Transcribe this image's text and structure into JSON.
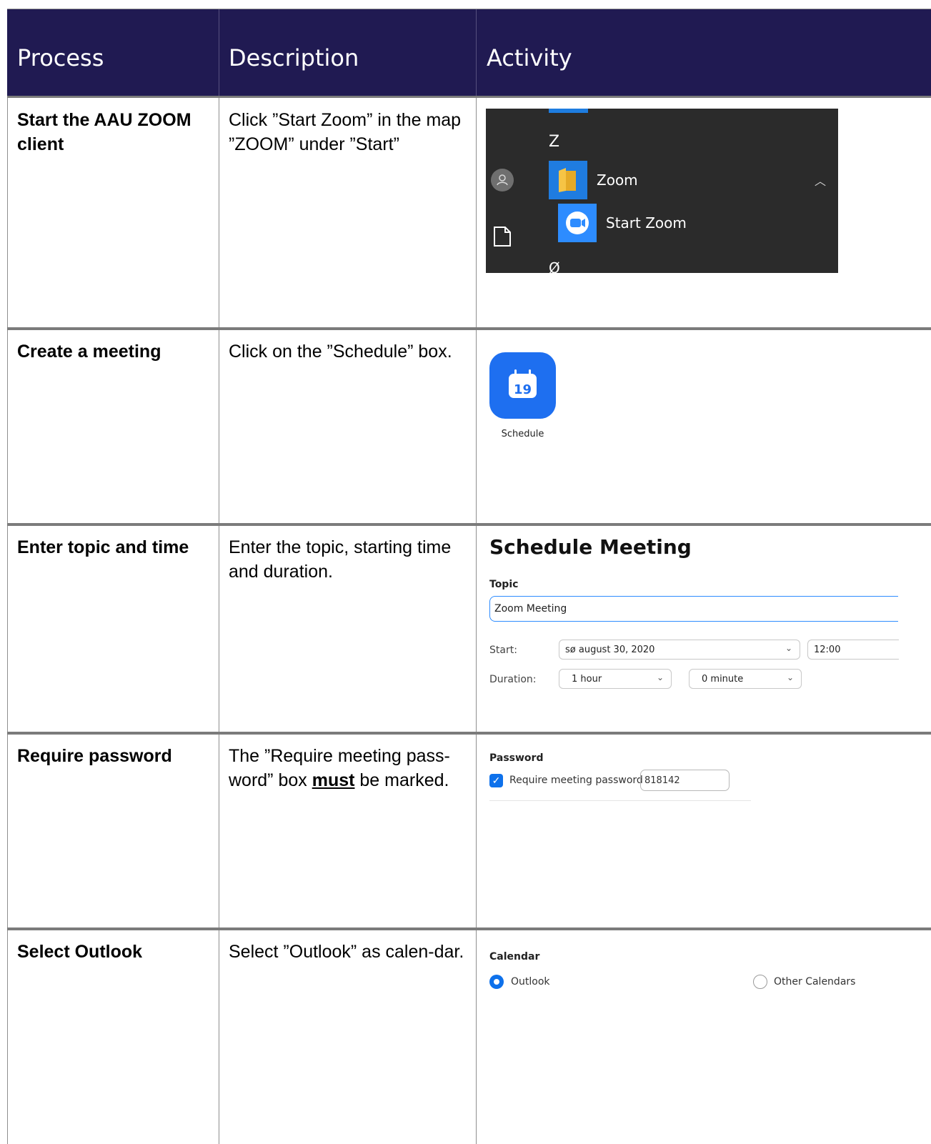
{
  "header": {
    "process": "Process",
    "description": "Description",
    "activity": "Activity"
  },
  "rows": [
    {
      "process": "Start the AAU ZOOM client",
      "description": "Click ”Start Zoom” in the map ”ZOOM” under ”Start”",
      "activity": {
        "letter_z": "Z",
        "folder_label": "Zoom",
        "app_label": "Start Zoom",
        "letter_oe": "Ø"
      }
    },
    {
      "process": "Create a meeting",
      "description": "Click on the ”Schedule” box.",
      "activity": {
        "icon_number": "19",
        "label": "Schedule"
      }
    },
    {
      "process": "Enter topic and time",
      "description": "Enter the topic, starting time and duration.",
      "activity": {
        "title": "Schedule Meeting",
        "topic_label": "Topic",
        "topic_value": "Zoom Meeting",
        "start_label": "Start:",
        "start_date": "sø  august  30, 2020",
        "start_time": "12:00",
        "duration_label": "Duration:",
        "duration_hours": "1 hour",
        "duration_minutes": "0 minute"
      }
    },
    {
      "process": "Require password",
      "description_pre": "The ”Require meeting pass-word” box ",
      "description_emph": "must",
      "description_post": " be marked.",
      "activity": {
        "section_label": "Password",
        "checkbox_label": "Require meeting password",
        "password_value": "818142",
        "checked": true
      }
    },
    {
      "process": "Select Outlook",
      "description": "Select ”Outlook” as calen-dar.",
      "activity": {
        "section_label": "Calendar",
        "option_selected": "Outlook",
        "option_other": "Other Calendars"
      }
    }
  ],
  "colors": {
    "header_bg": "#201a52",
    "zoom_blue": "#2d8cff",
    "start_tile": "#1f7ce0",
    "start_bg": "#2b2b2b"
  }
}
